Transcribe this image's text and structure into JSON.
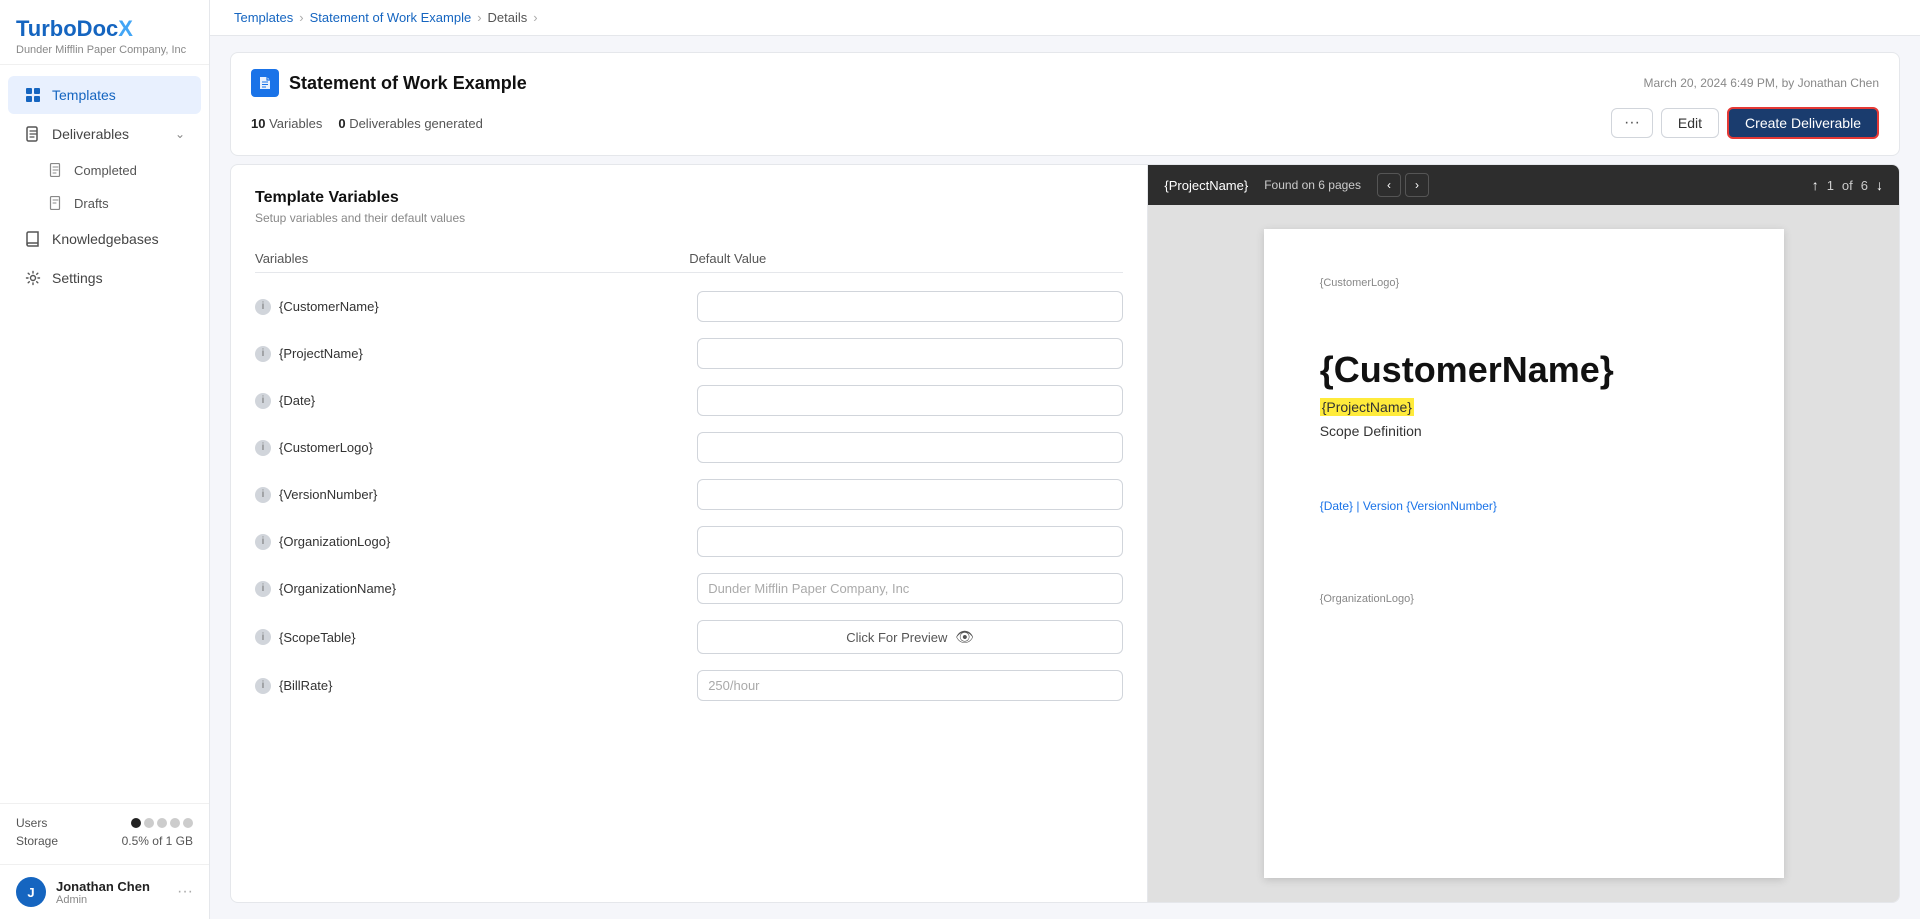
{
  "app": {
    "name": "TurboDoc",
    "name_suffix": "X",
    "company": "Dunder Mifflin Paper Company, Inc"
  },
  "sidebar": {
    "nav_items": [
      {
        "id": "templates",
        "label": "Templates",
        "icon": "grid",
        "active": true
      },
      {
        "id": "deliverables",
        "label": "Deliverables",
        "icon": "file",
        "has_arrow": true
      },
      {
        "id": "completed",
        "label": "Completed",
        "icon": "doc"
      },
      {
        "id": "drafts",
        "label": "Drafts",
        "icon": "doc-draft"
      },
      {
        "id": "knowledgebases",
        "label": "Knowledgebases",
        "icon": "book"
      },
      {
        "id": "settings",
        "label": "Settings",
        "icon": "gear"
      }
    ],
    "users_label": "Users",
    "storage_label": "Storage",
    "storage_value": "0.5% of 1 GB"
  },
  "user": {
    "name": "Jonathan Chen",
    "role": "Admin",
    "avatar_initial": "J"
  },
  "breadcrumb": {
    "items": [
      "Templates",
      "Statement of Work Example",
      "Details"
    ]
  },
  "template": {
    "title": "Statement of Work Example",
    "date": "March 20, 2024 6:49 PM, by Jonathan Chen",
    "variables_count": "10",
    "variables_label": "Variables",
    "deliverables_count": "0",
    "deliverables_label": "Deliverables generated"
  },
  "actions": {
    "more": "···",
    "edit": "Edit",
    "create": "Create Deliverable"
  },
  "variables_panel": {
    "title": "Template Variables",
    "subtitle": "Setup variables and their default values",
    "col_variables": "Variables",
    "col_default": "Default Value",
    "rows": [
      {
        "name": "{CustomerName}",
        "placeholder": "",
        "value": ""
      },
      {
        "name": "{ProjectName}",
        "placeholder": "",
        "value": ""
      },
      {
        "name": "{Date}",
        "placeholder": "",
        "value": ""
      },
      {
        "name": "{CustomerLogo}",
        "placeholder": "",
        "value": ""
      },
      {
        "name": "{VersionNumber}",
        "placeholder": "",
        "value": ""
      },
      {
        "name": "{OrganizationLogo}",
        "placeholder": "",
        "value": ""
      },
      {
        "name": "{OrganizationName}",
        "placeholder": "Dunder Mifflin Paper Company, Inc",
        "value": ""
      },
      {
        "name": "{ScopeTable}",
        "placeholder": "",
        "value": "",
        "is_preview": true,
        "preview_label": "Click For Preview"
      },
      {
        "name": "{BillRate}",
        "placeholder": "250/hour",
        "value": ""
      }
    ]
  },
  "preview": {
    "search_term": "{ProjectName}",
    "found_text": "Found on 6 pages",
    "page_current": "1",
    "page_total": "6",
    "customer_logo_var": "{CustomerLogo}",
    "customer_name_var": "{CustomerName}",
    "project_name_var": "{ProjectName}",
    "scope_label": "Scope Definition",
    "date_version_var": "{Date} | Version {VersionNumber}",
    "org_logo_var": "{OrganizationLogo}"
  }
}
